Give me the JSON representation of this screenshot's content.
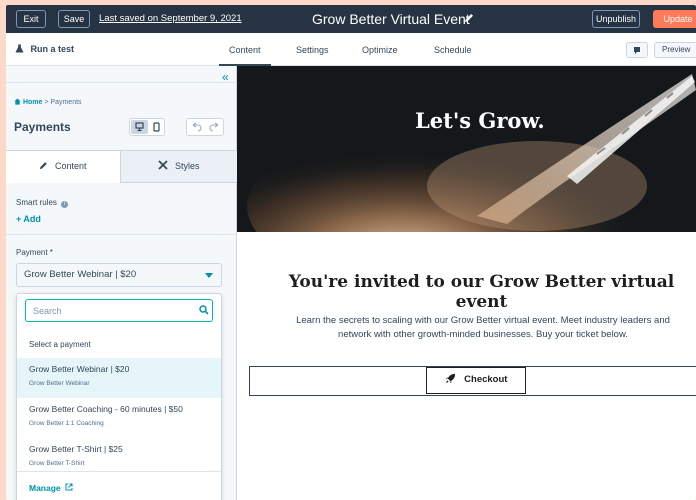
{
  "topbar": {
    "exit_label": "Exit",
    "save_label": "Save",
    "last_saved": "Last saved on September 9, 2021",
    "title": "Grow Better Virtual Event",
    "unpublish_label": "Unpublish",
    "update_label": "Update"
  },
  "subnav": {
    "run_test": "Run a test",
    "tabs": [
      "Content",
      "Settings",
      "Optimize",
      "Schedule"
    ],
    "active_tab": "Content",
    "preview_label": "Preview"
  },
  "sidebar": {
    "breadcrumb": {
      "home": "Home",
      "separator": ">",
      "current": "Payments"
    },
    "title": "Payments",
    "tabs": {
      "content": "Content",
      "styles": "Styles"
    },
    "smart_rules_label": "Smart rules",
    "add_label": "+ Add",
    "payment_field_label": "Payment *",
    "payment_selected": "Grow Better Webinar | $20"
  },
  "dropdown": {
    "search_placeholder": "Search",
    "hint": "Select a payment",
    "items": [
      {
        "label": "Grow Better Webinar | $20",
        "sub": "Grow Better Webinar",
        "selected": true
      },
      {
        "label": "Grow Better Coaching - 60 minutes | $50",
        "sub": "Grow Better 1:1 Coaching",
        "selected": false
      },
      {
        "label": "Grow Better T-Shirt | $25",
        "sub": "Grow Better T-Shirt",
        "selected": false
      }
    ],
    "manage_label": "Manage"
  },
  "canvas": {
    "hero_title": "Let's Grow.",
    "heading": "You're invited to our Grow Better virtual event",
    "description_line1": "Learn the secrets to scaling with our Grow Better virtual event. Meet industry leaders and",
    "description_line2": "network with other growth-minded businesses. Buy your ticket below.",
    "checkout_label": "Checkout"
  },
  "colors": {
    "topbar_bg": "#253342",
    "accent_orange": "#ff7a59",
    "link_teal": "#0091ae",
    "search_border": "#00bda5",
    "selected_row": "#e5f5f8",
    "page_bg": "#fcd9c8"
  },
  "icons": [
    "pencil-icon",
    "flask-icon",
    "comment-icon",
    "collapse-icon",
    "desktop-icon",
    "mobile-icon",
    "undo-icon",
    "redo-icon",
    "pencil-tab-icon",
    "styles-icon",
    "info-icon",
    "caret-down-icon",
    "search-icon",
    "external-link-icon",
    "rocket-icon",
    "home-icon"
  ]
}
